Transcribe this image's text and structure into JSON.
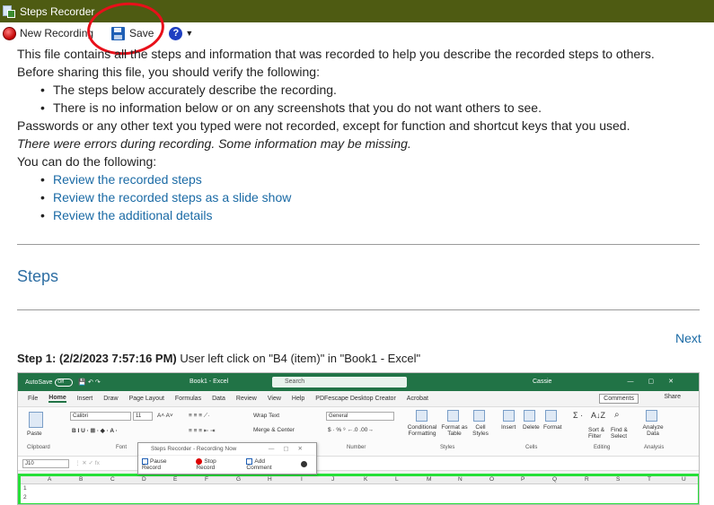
{
  "window": {
    "title": "Steps Recorder"
  },
  "toolbar": {
    "new_recording": "New Recording",
    "save": "Save",
    "help_glyph": "?"
  },
  "intro": {
    "line1": "This file contains all the steps and information that was recorded to help you describe the recorded steps to others.",
    "line2": "Before sharing this file, you should verify the following:",
    "bullets": [
      "The steps below accurately describe the recording.",
      "There is no information below or on any screenshots that you do not want others to see."
    ],
    "line3": "Passwords or any other text you typed were not recorded, except for function and shortcut keys that you used.",
    "errors": "There were errors during recording. Some information may be missing.",
    "line4": "You can do the following:",
    "links": [
      "Review the recorded steps",
      "Review the recorded steps as a slide show",
      "Review the additional details"
    ]
  },
  "steps": {
    "heading": "Steps",
    "next": "Next",
    "step1_label": "Step 1: (2/2/2023 7:57:16 PM)",
    "step1_text": "User left click on \"B4 (item)\" in \"Book1 - Excel\""
  },
  "excel": {
    "autosave": "AutoSave",
    "autosave_state": "Off",
    "book_title": "Book1 - Excel",
    "search": "Search",
    "user": "Cassie",
    "tabs": [
      "File",
      "Home",
      "Insert",
      "Draw",
      "Page Layout",
      "Formulas",
      "Data",
      "Review",
      "View",
      "Help",
      "PDFescape Desktop Creator",
      "Acrobat"
    ],
    "comments": "Comments",
    "share": "Share",
    "font_name": "Calibri",
    "font_size": "11",
    "wrap_text": "Wrap Text",
    "merge_center": "Merge & Center",
    "number_format": "General",
    "paste": "Paste",
    "groups": [
      "Clipboard",
      "Font",
      "Number",
      "Styles",
      "Cells",
      "Editing",
      "Analysis"
    ],
    "styles_btns": [
      "Conditional Formatting",
      "Format as Table",
      "Cell Styles"
    ],
    "cells_btns": [
      "Insert",
      "Delete",
      "Format"
    ],
    "editing_btns": [
      "Sort & Filter",
      "Find & Select"
    ],
    "analysis_btn": "Analyze Data",
    "name_box": "J10",
    "columns": [
      "A",
      "B",
      "C",
      "D",
      "E",
      "F",
      "G",
      "H",
      "I",
      "J",
      "K",
      "L",
      "M",
      "N",
      "O",
      "P",
      "Q",
      "R",
      "S",
      "T",
      "U"
    ],
    "rows": [
      "1",
      "2"
    ]
  },
  "popup": {
    "title": "Steps Recorder - Recording Now",
    "pause": "Pause Record",
    "stop": "Stop Record",
    "add_comment": "Add Comment"
  }
}
